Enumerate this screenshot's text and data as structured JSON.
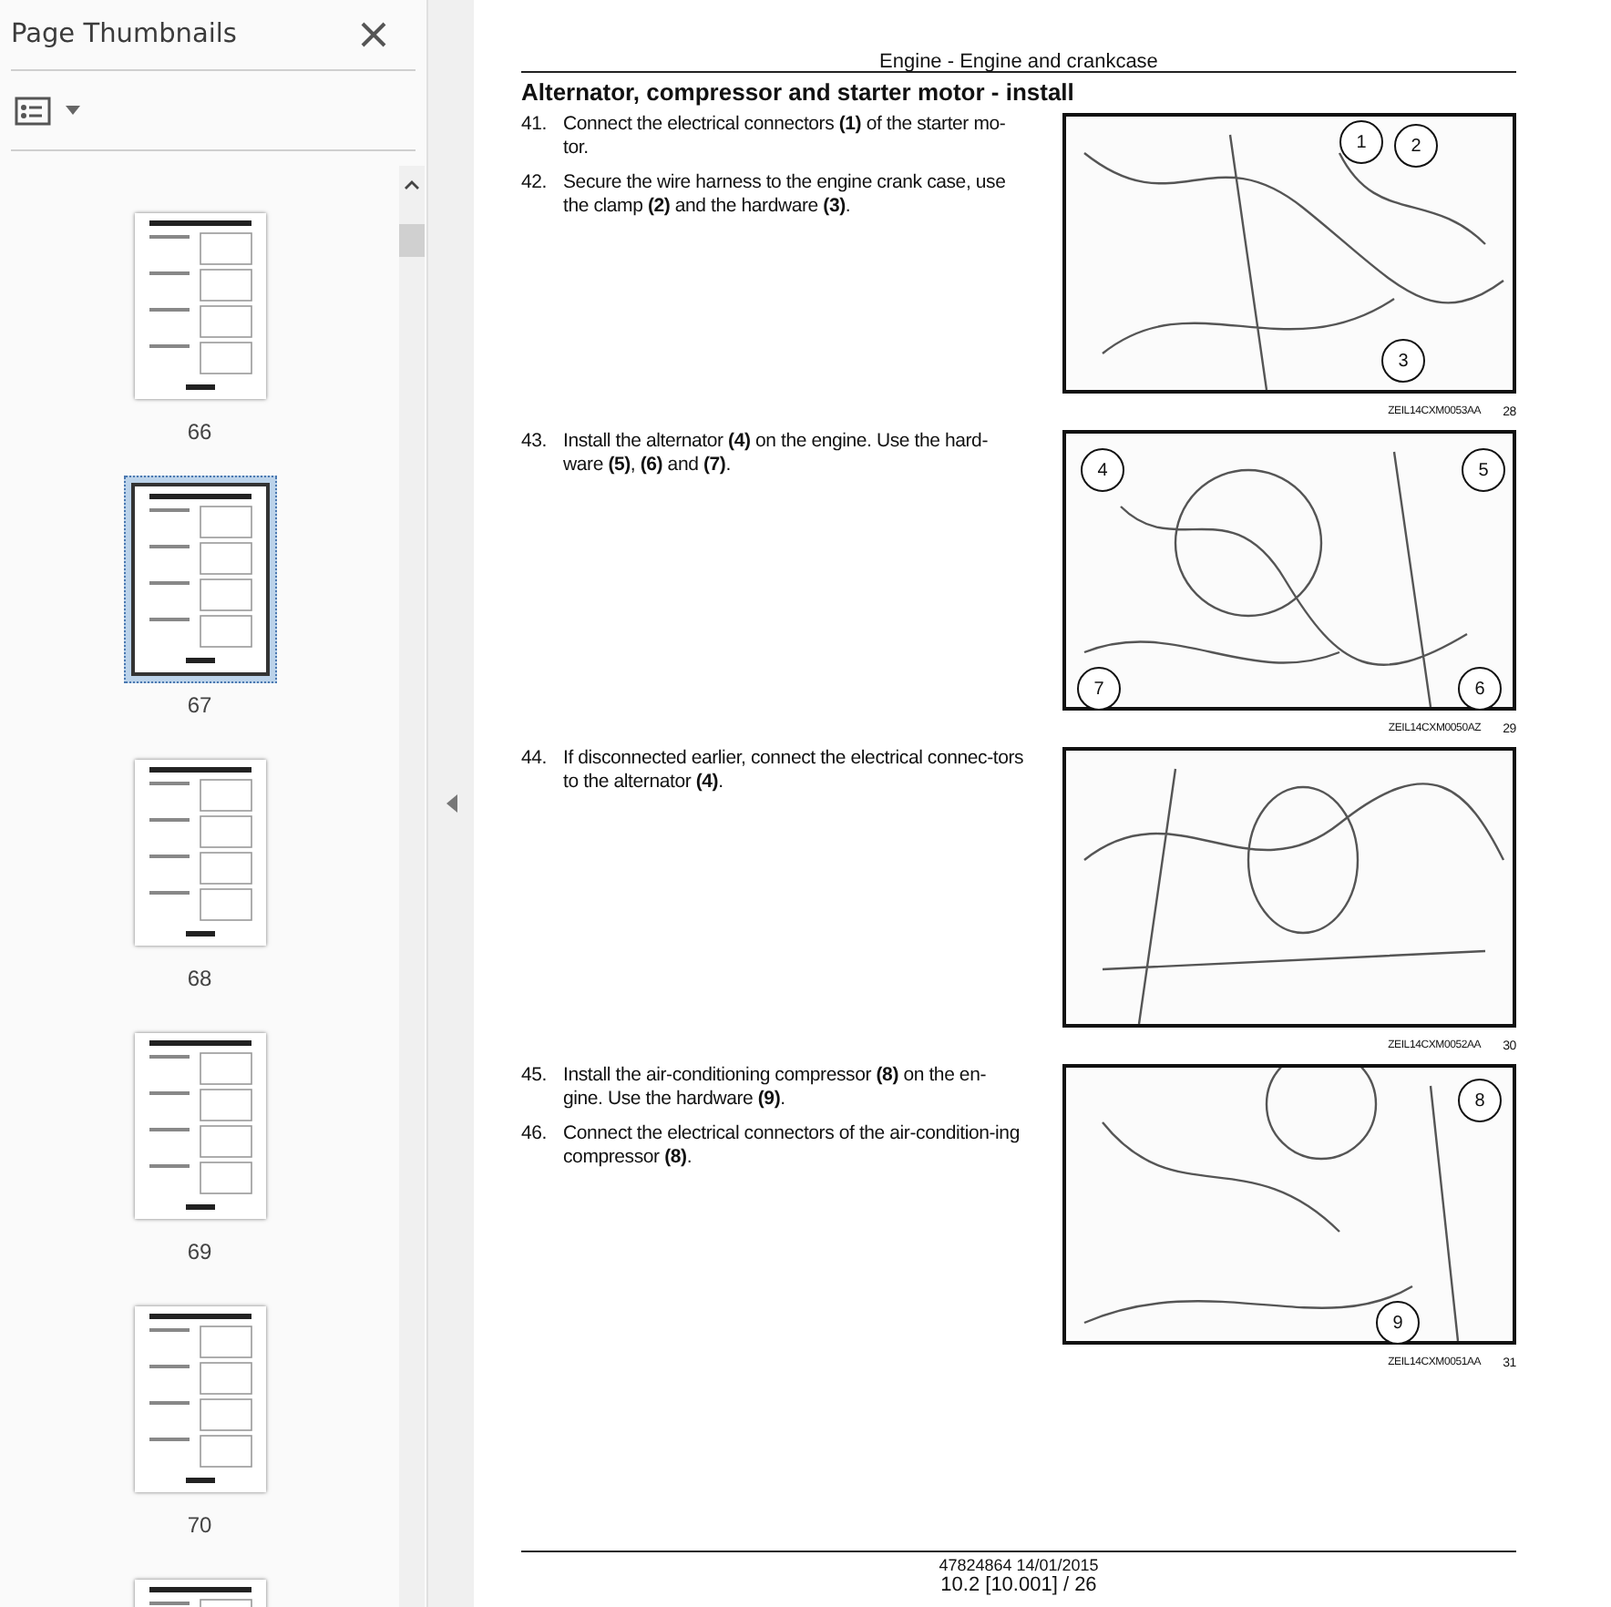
{
  "sidebar": {
    "title": "Page Thumbnails",
    "thumbnails": [
      {
        "label": "66",
        "selected": false
      },
      {
        "label": "67",
        "selected": true
      },
      {
        "label": "68",
        "selected": false
      },
      {
        "label": "69",
        "selected": false
      },
      {
        "label": "70",
        "selected": false
      },
      {
        "selected": false
      }
    ]
  },
  "page": {
    "header": "Engine - Engine and crankcase",
    "title": "Alternator, compressor and starter motor - install",
    "sections": [
      {
        "steps": [
          {
            "number": "41.",
            "text": "Connect the electrical connectors **(1)** of the starter mo-tor."
          },
          {
            "number": "42.",
            "text": "Secure the wire harness to the engine crank case, use the clamp **(2)** and the hardware **(3)**."
          }
        ],
        "figure": {
          "callouts": [
            "1",
            "2",
            "3"
          ],
          "code": "ZEIL14CXM0053AA",
          "number": "28"
        }
      },
      {
        "steps": [
          {
            "number": "43.",
            "text": "Install the alternator **(4)** on the engine.  Use the hard-ware **(5)**, **(6)** and **(7)**."
          }
        ],
        "figure": {
          "callouts": [
            "4",
            "5",
            "7",
            "6"
          ],
          "code": "ZEIL14CXM0050AZ",
          "number": "29"
        }
      },
      {
        "steps": [
          {
            "number": "44.",
            "text": "If disconnected earlier, connect the electrical connec-tors to the alternator **(4)**."
          }
        ],
        "figure": {
          "code": "ZEIL14CXM0052AA",
          "number": "30"
        }
      },
      {
        "steps": [
          {
            "number": "45.",
            "text": "Install the air-conditioning compressor **(8)** on the en-gine.  Use the hardware **(9)**."
          },
          {
            "number": "46.",
            "text": "Connect the electrical connectors of the air-condition-ing compressor **(8)**."
          }
        ],
        "figure": {
          "callouts": [
            "8",
            "9"
          ],
          "code": "ZEIL14CXM0051AA",
          "number": "31"
        }
      }
    ],
    "footer": {
      "doc_line": "47824864 14/01/2015",
      "page_line": "10.2 [10.001] / 26"
    }
  }
}
